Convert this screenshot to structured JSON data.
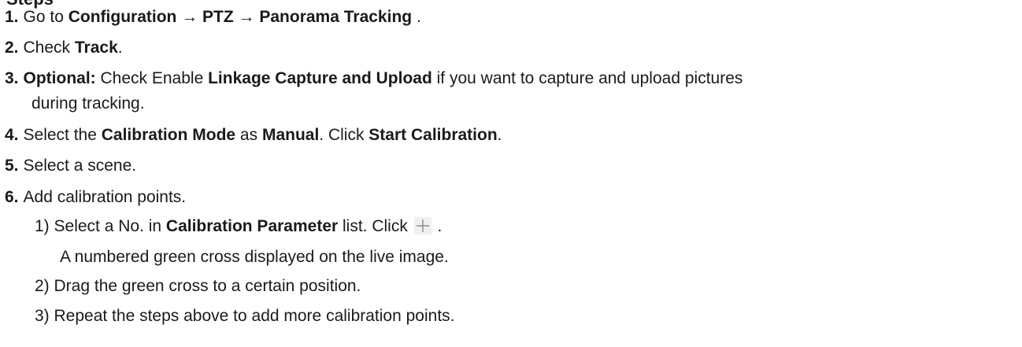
{
  "heading_partial": "Steps",
  "steps": [
    {
      "num": "1.",
      "parts": [
        "Go to ",
        "Configuration → PTZ → Panorama Tracking",
        " ."
      ]
    },
    {
      "num": "2.",
      "parts": [
        "Check ",
        "Track",
        "."
      ]
    },
    {
      "num": "3.",
      "parts": [
        "Optional:",
        " Check Enable ",
        "Linkage Capture and Upload",
        " if you want to capture and upload pictures"
      ],
      "continuation": "during tracking."
    },
    {
      "num": "4.",
      "parts": [
        "Select the ",
        "Calibration Mode",
        " as ",
        "Manual",
        ". Click ",
        "Start Calibration",
        "."
      ]
    },
    {
      "num": "5.",
      "parts": [
        "Select a scene."
      ]
    },
    {
      "num": "6.",
      "parts": [
        "Add calibration points."
      ]
    }
  ],
  "substeps": [
    {
      "parts": [
        "1) Select a No. in ",
        "Calibration Parameter",
        " list. Click ",
        " ."
      ],
      "note": "A numbered green cross displayed on the live image."
    },
    {
      "parts": [
        "2) Drag the green cross to a certain position."
      ]
    },
    {
      "parts": [
        "3) Repeat the steps above to add more calibration points."
      ]
    }
  ],
  "icons": {
    "add": "plus-icon"
  }
}
